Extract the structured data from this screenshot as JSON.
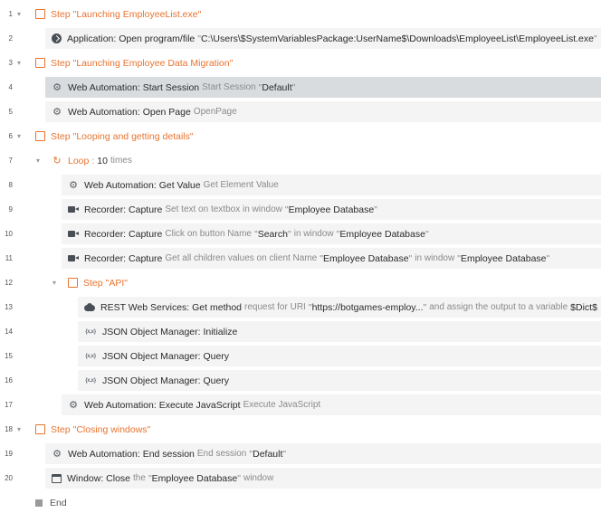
{
  "rows": [
    {
      "n": "1",
      "step_word": "Step",
      "step_title": "Launching EmployeeList.exe"
    },
    {
      "n": "2",
      "name": "Application: Open program/file",
      "path": "C:\\Users\\$SystemVariablesPackage:UserName$\\Downloads\\EmployeeList\\EmployeeList.exe"
    },
    {
      "n": "3",
      "step_word": "Step",
      "step_title": "Launching Employee Data Migration"
    },
    {
      "n": "4",
      "name": "Web Automation: Start Session",
      "desc": "Start Session",
      "value": "Default"
    },
    {
      "n": "5",
      "name": "Web Automation: Open Page",
      "desc": "OpenPage"
    },
    {
      "n": "6",
      "step_word": "Step",
      "step_title": "Looping and getting details"
    },
    {
      "n": "7",
      "loop_word": "Loop",
      "count": "10",
      "times": "times"
    },
    {
      "n": "8",
      "name": "Web Automation: Get Value",
      "desc": "Get Element Value"
    },
    {
      "n": "9",
      "name": "Recorder: Capture",
      "desc": "Set text on textbox in window",
      "window": "Employee Database"
    },
    {
      "n": "10",
      "name": "Recorder: Capture",
      "desc": "Click on button Name",
      "button": "Search",
      "in_window": "in window",
      "window": "Employee Database"
    },
    {
      "n": "11",
      "name": "Recorder: Capture",
      "desc": "Get all children values on client Name",
      "client": "Employee Database",
      "in_window": "in window",
      "window": "Employee Database"
    },
    {
      "n": "12",
      "step_word": "Step",
      "step_title": "API"
    },
    {
      "n": "13",
      "name": "REST Web Services: Get method",
      "desc": "request for URI",
      "uri": "https://botgames-employ...",
      "assign": "and assign the output to a variable",
      "variable": "$Dict$"
    },
    {
      "n": "14",
      "name": "JSON Object Manager: Initialize"
    },
    {
      "n": "15",
      "name": "JSON Object Manager: Query"
    },
    {
      "n": "16",
      "name": "JSON Object Manager: Query"
    },
    {
      "n": "17",
      "name": "Web Automation: Execute JavaScript",
      "desc": "Execute JavaScript"
    },
    {
      "n": "18",
      "step_word": "Step",
      "step_title": "Closing windows"
    },
    {
      "n": "19",
      "name": "Web Automation: End session",
      "desc": "End session",
      "value": "Default"
    },
    {
      "n": "20",
      "name": "Window: Close",
      "desc": "the",
      "window": "Employee Database",
      "suffix": "window"
    }
  ],
  "end_label": "End",
  "icons": {
    "step": "step-square-icon",
    "app": "application-icon",
    "web": "web-automation-icon",
    "loop": "loop-icon",
    "recorder": "recorder-camera-icon",
    "rest": "cloud-icon",
    "json": "json-icon",
    "window": "window-icon"
  },
  "colors": {
    "accent": "#e8732e",
    "selected_row": "#d9dcdf",
    "row_bg": "#f4f4f4"
  }
}
